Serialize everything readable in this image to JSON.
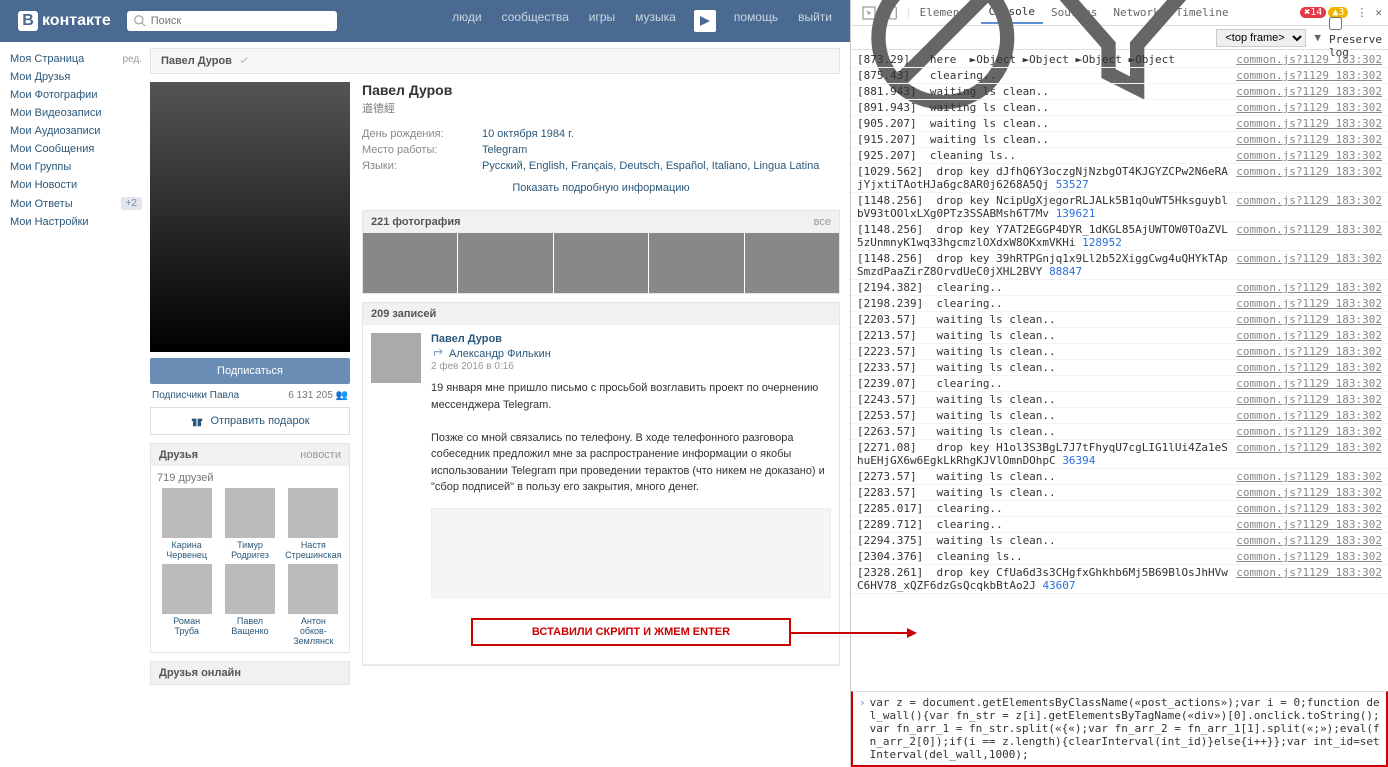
{
  "topbar": {
    "logo": "контакте",
    "search_placeholder": "Поиск",
    "nav": [
      "люди",
      "сообщества",
      "игры",
      "музыка"
    ],
    "nav2": [
      "помощь",
      "выйти"
    ]
  },
  "leftnav": {
    "items": [
      {
        "label": "Моя Страница",
        "extra": "ред."
      },
      {
        "label": "Мои Друзья"
      },
      {
        "label": "Мои Фотографии"
      },
      {
        "label": "Мои Видеозаписи"
      },
      {
        "label": "Мои Аудиозаписи"
      },
      {
        "label": "Мои Сообщения"
      },
      {
        "label": "Мои Группы"
      },
      {
        "label": "Мои Новости"
      },
      {
        "label": "Мои Ответы",
        "badge": "+2"
      },
      {
        "label": "Мои Настройки"
      }
    ]
  },
  "profile": {
    "header_name": "Павел Дуров",
    "name": "Павел Дуров",
    "status": "道德經",
    "birthday_lbl": "День рождения:",
    "birthday": "10 октября 1984 г.",
    "work_lbl": "Место работы:",
    "work": "Telegram",
    "lang_lbl": "Языки:",
    "langs": "Русский, English, Français, Deutsch, Español, Italiano, Lingua Latina",
    "show_more": "Показать подробную информацию",
    "subscribe_btn": "Подписаться",
    "subs_lbl": "Подписчики Павла",
    "subs_cnt": "6 131 205",
    "gift_btn": "Отправить подарок",
    "photos_header": "221 фотография",
    "photos_all": "все",
    "posts_header": "209 записей",
    "friends_header": "Друзья",
    "friends_more": "новости",
    "friends_cnt": "719 друзей",
    "friends": [
      {
        "n1": "Карина",
        "n2": "Червенец"
      },
      {
        "n1": "Тимур",
        "n2": "Родригез"
      },
      {
        "n1": "Настя",
        "n2": "Стрешинская"
      },
      {
        "n1": "Роман",
        "n2": "Труба"
      },
      {
        "n1": "Павел",
        "n2": "Ващенко"
      },
      {
        "n1": "Антон",
        "n2": "обков-Землянск"
      }
    ],
    "friends_online": "Друзья онлайн"
  },
  "post": {
    "author": "Павел Дуров",
    "reposter": "Александр Филькин",
    "date": "2 фев 2016 в 0:16",
    "text1": "19 января мне пришло письмо с просьбой возглавить проект по очернению мессенджера Telegram.",
    "text2": "Позже со мной связались по телефону. В ходе телефонного разговора собеседник предложил мне за распространение информации о якобы использовании Telegram при проведении терактов (что никем не доказано) и \"сбор подписей\" в пользу его закрытия, много денег."
  },
  "callout": "ВСТАВИЛИ СКРИПТ И ЖМЕМ ENTER",
  "devtools": {
    "tabs": [
      "Elements",
      "Console",
      "Sources",
      "Network",
      "Timeline"
    ],
    "active_tab": "Console",
    "errors": "14",
    "warnings": "3",
    "frame": "<top frame>",
    "preserve": "Preserve log",
    "source": "common.js?1129 183:302",
    "logs": [
      "[873.29]   here  ►Object ►Object ►Object ►Object",
      "[875.43]   clearing..",
      "[881.943]  waiting ls clean..",
      "[891.943]  waiting ls clean..",
      "[905.207]  waiting ls clean..",
      "[915.207]  waiting ls clean..",
      "[925.207]  cleaning ls..",
      "[1029.562]  drop key dJfhQ6Y3oczgNjNzbgOT4KJGYZCPw2N6eRAjYjxtiTAotHJa6gc8AR0j6268A5Qj 53527",
      "[1148.256]  drop key NcipUgXjegorRLJALk5B1qOuWT5HksguyblbV93tOOlxLXg0PTz3SSABMsh6T7Mv 139621",
      "[1148.256]  drop key Y7AT2EGGP4DYR_1dKGL85AjUWTOW0TOaZVL5zUnmnyK1wq33hgcmzlOXdxW8OKxmVKHi 128952",
      "[1148.256]  drop key 39hRTPGnjq1x9Ll2b52XiggCwg4uQHYkTApSmzdPaaZirZ8OrvdUeC0jXHL2BVY 88847",
      "[2194.382]  clearing..",
      "[2198.239]  clearing..",
      "[2203.57]   waiting ls clean..",
      "[2213.57]   waiting ls clean..",
      "[2223.57]   waiting ls clean..",
      "[2233.57]   waiting ls clean..",
      "[2239.07]   clearing..",
      "[2243.57]   waiting ls clean..",
      "[2253.57]   waiting ls clean..",
      "[2263.57]   waiting ls clean..",
      "[2271.08]   drop key H1ol3S3BgL7J7tFhyqU7cgLIG1lUi4Za1eShuEHjGX6w6EgkLkRhgKJVlOmnDOhpC 36394",
      "[2273.57]   waiting ls clean..",
      "[2283.57]   waiting ls clean..",
      "[2285.017]  clearing..",
      "[2289.712]  clearing..",
      "[2294.375]  waiting ls clean..",
      "[2304.376]  cleaning ls..",
      "[2328.261]  drop key CfUa6d3s3CHgfxGhkhb6Mj5B69BlOsJhHVwC6HV78_xQZF6dzGsQcqkbBtAo2J 43607"
    ],
    "input": "var z = document.getElementsByClassName(«post_actions»);var i = 0;function del_wall(){var fn_str = z[i].getElementsByTagName(«div»)[0].onclick.toString();var fn_arr_1 = fn_str.split(«{«);var fn_arr_2 = fn_arr_1[1].split(«;»);eval(fn_arr_2[0]);if(i == z.length){clearInterval(int_id)}else{i++}};var int_id=setInterval(del_wall,1000);"
  }
}
